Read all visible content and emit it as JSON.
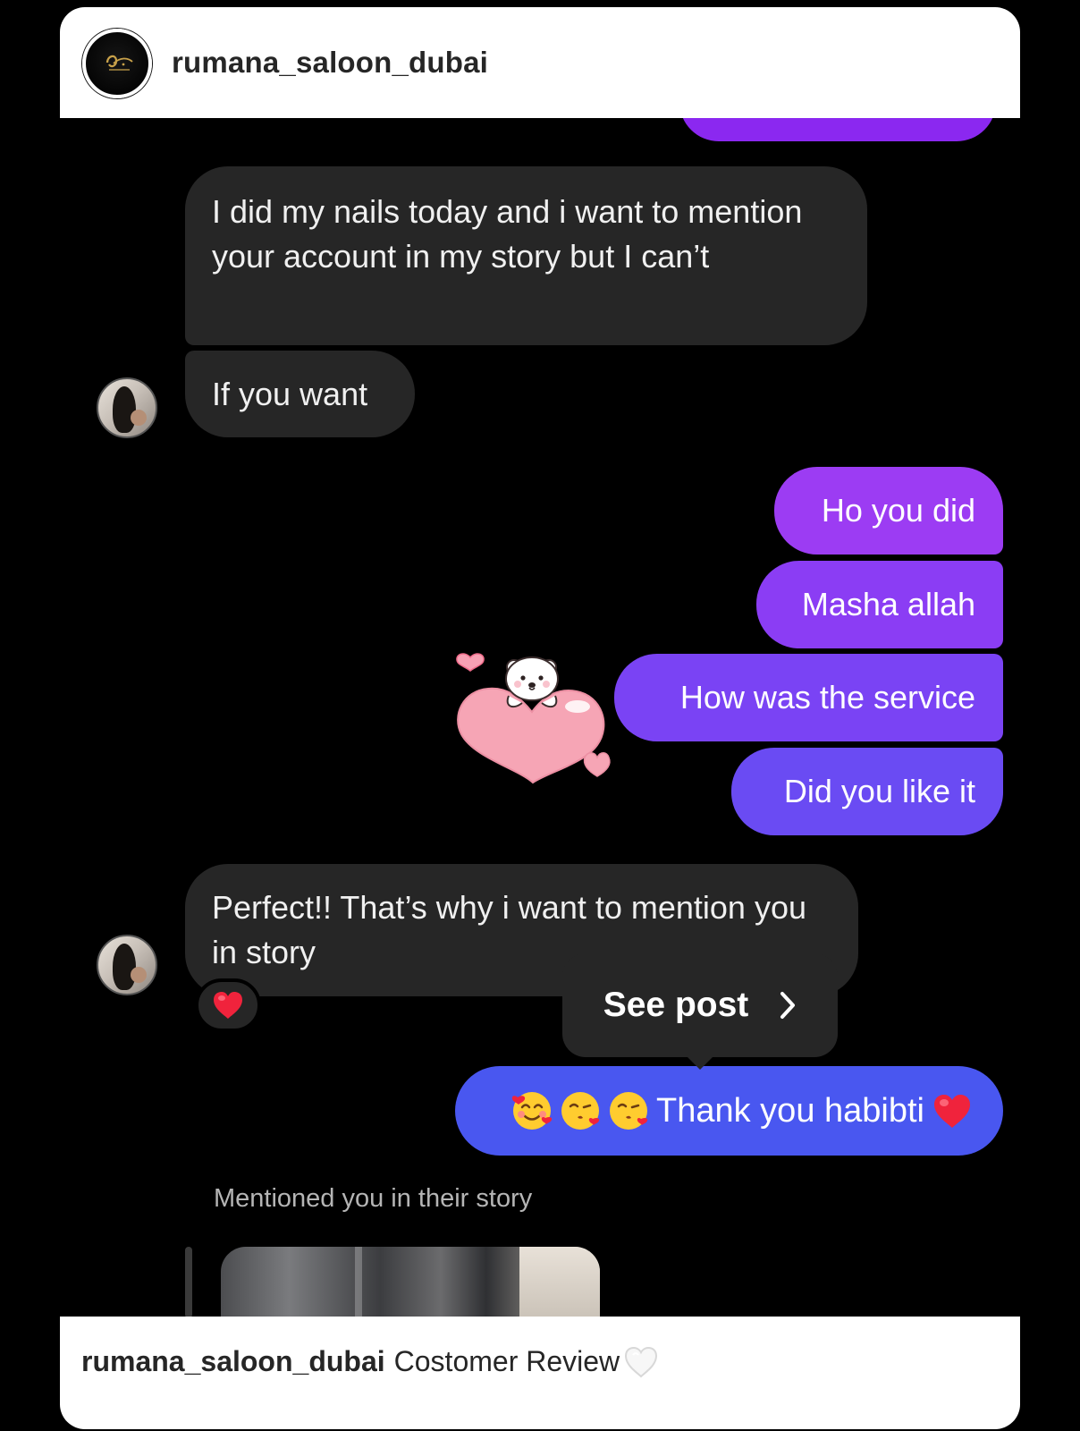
{
  "header": {
    "username": "rumana_saloon_dubai",
    "avatar": "salon-logo-icon"
  },
  "messages": [
    {
      "side": "incoming",
      "text": "I did my nails today and i want to mention your account in my story but I can’t"
    },
    {
      "side": "incoming",
      "text": "If you want"
    },
    {
      "side": "outgoing",
      "text": "Ho you did"
    },
    {
      "side": "outgoing",
      "text": "Masha allah"
    },
    {
      "side": "outgoing",
      "text": "How was the service"
    },
    {
      "side": "outgoing",
      "text": "Did you like it"
    },
    {
      "side": "incoming",
      "text": "Perfect!! That’s why i want to mention you in story",
      "reaction": "red-heart-icon"
    },
    {
      "side": "outgoing",
      "text": "Thank you habibti",
      "emojis": [
        "smiling-face-with-hearts-icon",
        "face-blowing-kiss-icon",
        "face-blowing-kiss-icon"
      ],
      "trailing_emoji": "red-heart-icon"
    }
  ],
  "tooltip": {
    "label": "See post"
  },
  "story": {
    "mention_text": "Mentioned you in their story"
  },
  "caption": {
    "username": "rumana_saloon_dubai",
    "text": "Costomer Review"
  },
  "colors": {
    "incoming_bubble": "#262626",
    "outgoing_gradient": [
      "#9c3cf3",
      "#8b3df4",
      "#7a43f4",
      "#6a4bf3",
      "#4957f0"
    ],
    "background": "#000000",
    "card": "#ffffff"
  },
  "icons": {
    "sticker": "bear-heart-sticker-icon",
    "chevron": "chevron-right-icon",
    "caption_end": "white-heart-icon"
  }
}
